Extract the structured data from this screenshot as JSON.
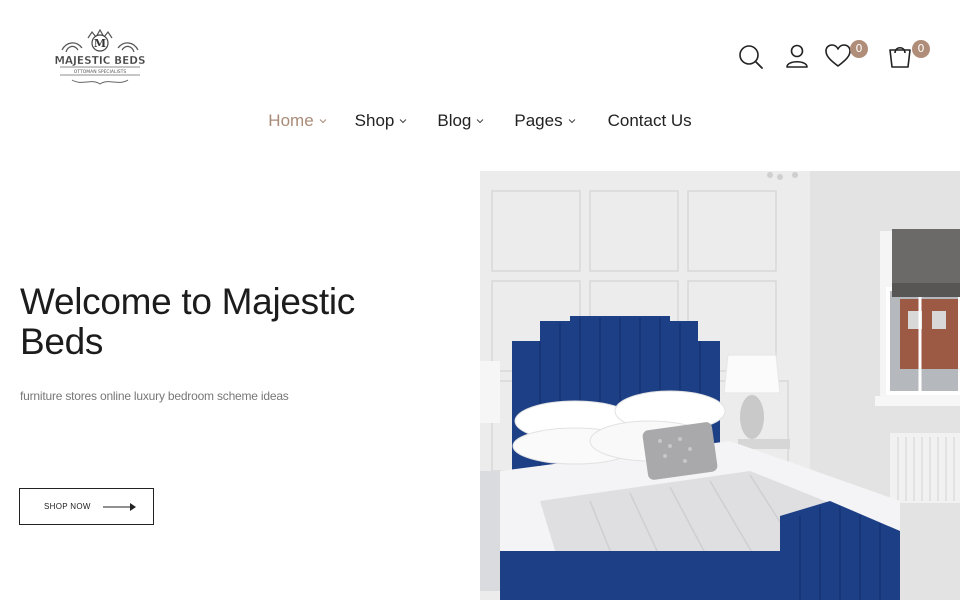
{
  "brand": {
    "name": "MAJESTIC BEDS",
    "tagline": "OTTOMAN SPECIALISTS",
    "monogram": "M"
  },
  "header": {
    "wishlist_count": "0",
    "cart_count": "0",
    "icons": [
      "search-icon",
      "user-icon",
      "heart-icon",
      "bag-icon"
    ]
  },
  "nav": {
    "items": [
      {
        "label": "Home",
        "dropdown": true,
        "active": true
      },
      {
        "label": "Shop",
        "dropdown": true,
        "active": false
      },
      {
        "label": "Blog",
        "dropdown": true,
        "active": false
      },
      {
        "label": "Pages",
        "dropdown": true,
        "active": false
      },
      {
        "label": "Contact Us",
        "dropdown": false,
        "active": false
      }
    ]
  },
  "hero": {
    "title": "Welcome to Majestic Beds",
    "subtitle": "furniture stores online luxury bedroom scheme ideas",
    "button_label": "SHOP NOW"
  },
  "colors": {
    "accent": "#a98b78",
    "badge": "#b08d79",
    "text": "#222222",
    "bed_blue": "#1d3f86"
  }
}
